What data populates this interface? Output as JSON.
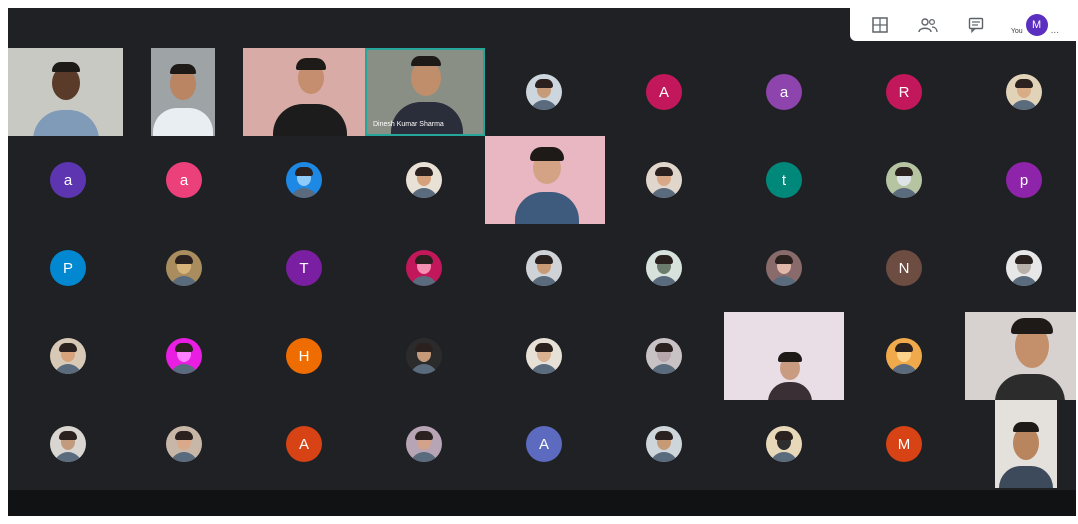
{
  "topbar": {
    "icons": [
      "layout-grid-icon",
      "people-icon",
      "chat-icon"
    ],
    "you_label": "You",
    "you_initial": "M",
    "more": "..."
  },
  "videos": [
    {
      "id": "v1",
      "kind": "man-headset",
      "bg": "#c9c9c4",
      "shirt": "#7f9bb8"
    },
    {
      "id": "v2",
      "kind": "man-car",
      "bg": "#9ea3a6",
      "shirt": "#e8eef2"
    },
    {
      "id": "v3",
      "kind": "woman-pink",
      "bg": "#d8aba6",
      "shirt": "#1c1c1c"
    },
    {
      "id": "v4",
      "kind": "man-glasses",
      "bg": "#8a8f85",
      "shirt": "#2a2d3a",
      "name": "Dinesh Kumar Sharma"
    },
    {
      "id": "v5",
      "kind": "girl-room",
      "bg": "#e8b7c2",
      "shirt": "#3e5a7c"
    },
    {
      "id": "v6",
      "kind": "girl-wall",
      "bg": "#e9dde6",
      "shirt": "#3a2f35"
    },
    {
      "id": "v7",
      "kind": "woman-headset",
      "bg": "#d7d2cf",
      "shirt": "#2c2c2c"
    },
    {
      "id": "v8",
      "kind": "man-beard",
      "bg": "#e4e1dd",
      "shirt": "#3c4a5c"
    }
  ],
  "tiles": [
    {
      "type": "photo",
      "bg": "#cdd6dd",
      "skin": "#c89b78"
    },
    {
      "type": "letter",
      "letter": "A",
      "color": "#c2185b"
    },
    {
      "type": "letter",
      "letter": "a",
      "color": "#8e44ad"
    },
    {
      "type": "letter",
      "letter": "R",
      "color": "#c2185b"
    },
    {
      "type": "photo",
      "bg": "#e0d3b8",
      "skin": "#d8ad86"
    },
    {
      "type": "letter",
      "letter": "a",
      "color": "#5e35b1"
    },
    {
      "type": "letter",
      "letter": "a",
      "color": "#ec407a"
    },
    {
      "type": "photo",
      "bg": "#1e88e5",
      "skin": "#90caf9"
    },
    {
      "type": "photo",
      "bg": "#e9e1d6",
      "skin": "#d5a27c"
    },
    {
      "type": "photo",
      "bg": "#e1d6cc",
      "skin": "#d9a987"
    },
    {
      "type": "letter",
      "letter": "t",
      "color": "#00897b"
    },
    {
      "type": "photo",
      "bg": "#b6c4a1",
      "skin": "#dde3e6"
    },
    {
      "type": "letter",
      "letter": "p",
      "color": "#8e24aa"
    },
    {
      "type": "letter",
      "letter": "P",
      "color": "#0288d1"
    },
    {
      "type": "photo",
      "bg": "#a98d5e",
      "skin": "#d9b47a"
    },
    {
      "type": "letter",
      "letter": "T",
      "color": "#7b1fa2"
    },
    {
      "type": "photo",
      "bg": "#c2185b",
      "skin": "#f48fb1"
    },
    {
      "type": "photo",
      "bg": "#cfd2d6",
      "skin": "#c99a76"
    },
    {
      "type": "photo",
      "bg": "#d8e2dc",
      "skin": "#6b7b6d"
    },
    {
      "type": "photo",
      "bg": "#8a6b6b",
      "skin": "#e0b7a8"
    },
    {
      "type": "letter",
      "letter": "N",
      "color": "#6d4c41"
    },
    {
      "type": "photo",
      "bg": "#e7e7e7",
      "skin": "#b7b1aa"
    },
    {
      "type": "photo",
      "bg": "#d8c9b6",
      "skin": "#d7a37d"
    },
    {
      "type": "photo",
      "bg": "#e91ee2",
      "skin": "#ff80ff"
    },
    {
      "type": "letter",
      "letter": "H",
      "color": "#ef6c00"
    },
    {
      "type": "photo",
      "bg": "#2b2b2b",
      "skin": "#c49a7b"
    },
    {
      "type": "photo",
      "bg": "#e6e0d6",
      "skin": "#d8b190"
    },
    {
      "type": "photo",
      "bg": "#c9c2c5",
      "skin": "#b7a6ac"
    },
    {
      "type": "photo",
      "bg": "#f0a94b",
      "skin": "#ffd48a"
    },
    {
      "type": "photo",
      "bg": "#d9d6d2",
      "skin": "#c29a7e"
    },
    {
      "type": "photo",
      "bg": "#c8b7a7",
      "skin": "#d9a989"
    },
    {
      "type": "letter",
      "letter": "A",
      "color": "#d84315"
    },
    {
      "type": "photo",
      "bg": "#b7a5b6",
      "skin": "#d2a28a"
    },
    {
      "type": "letter",
      "letter": "A",
      "color": "#5c6bc0"
    },
    {
      "type": "photo",
      "bg": "#cfd6db",
      "skin": "#c79a76"
    },
    {
      "type": "photo",
      "bg": "#e6d8b8",
      "skin": "#2e2e2e"
    },
    {
      "type": "letter",
      "letter": "M",
      "color": "#d84315"
    }
  ]
}
